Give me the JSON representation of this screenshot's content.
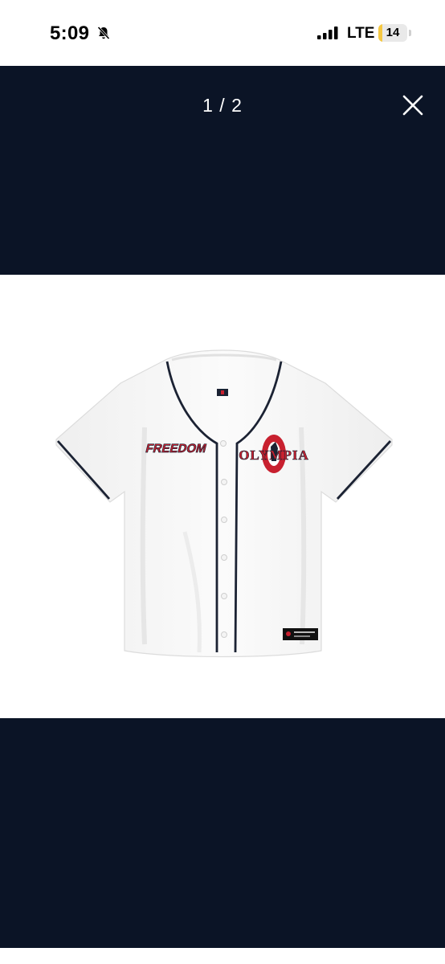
{
  "status_bar": {
    "time": "5:09",
    "mute_icon": "bell-slash-icon",
    "network": "LTE",
    "battery": {
      "level_text": "14",
      "level_percent": 14,
      "color": "#f5c842"
    }
  },
  "viewer": {
    "counter": "1 / 2",
    "close_icon": "close-icon",
    "background_color": "#0b1426"
  },
  "product": {
    "left_chest_text": "FREEDOM",
    "logo_text": "OLYMPIA",
    "trim_color": "#1b2233",
    "accent_color": "#c8202f"
  }
}
